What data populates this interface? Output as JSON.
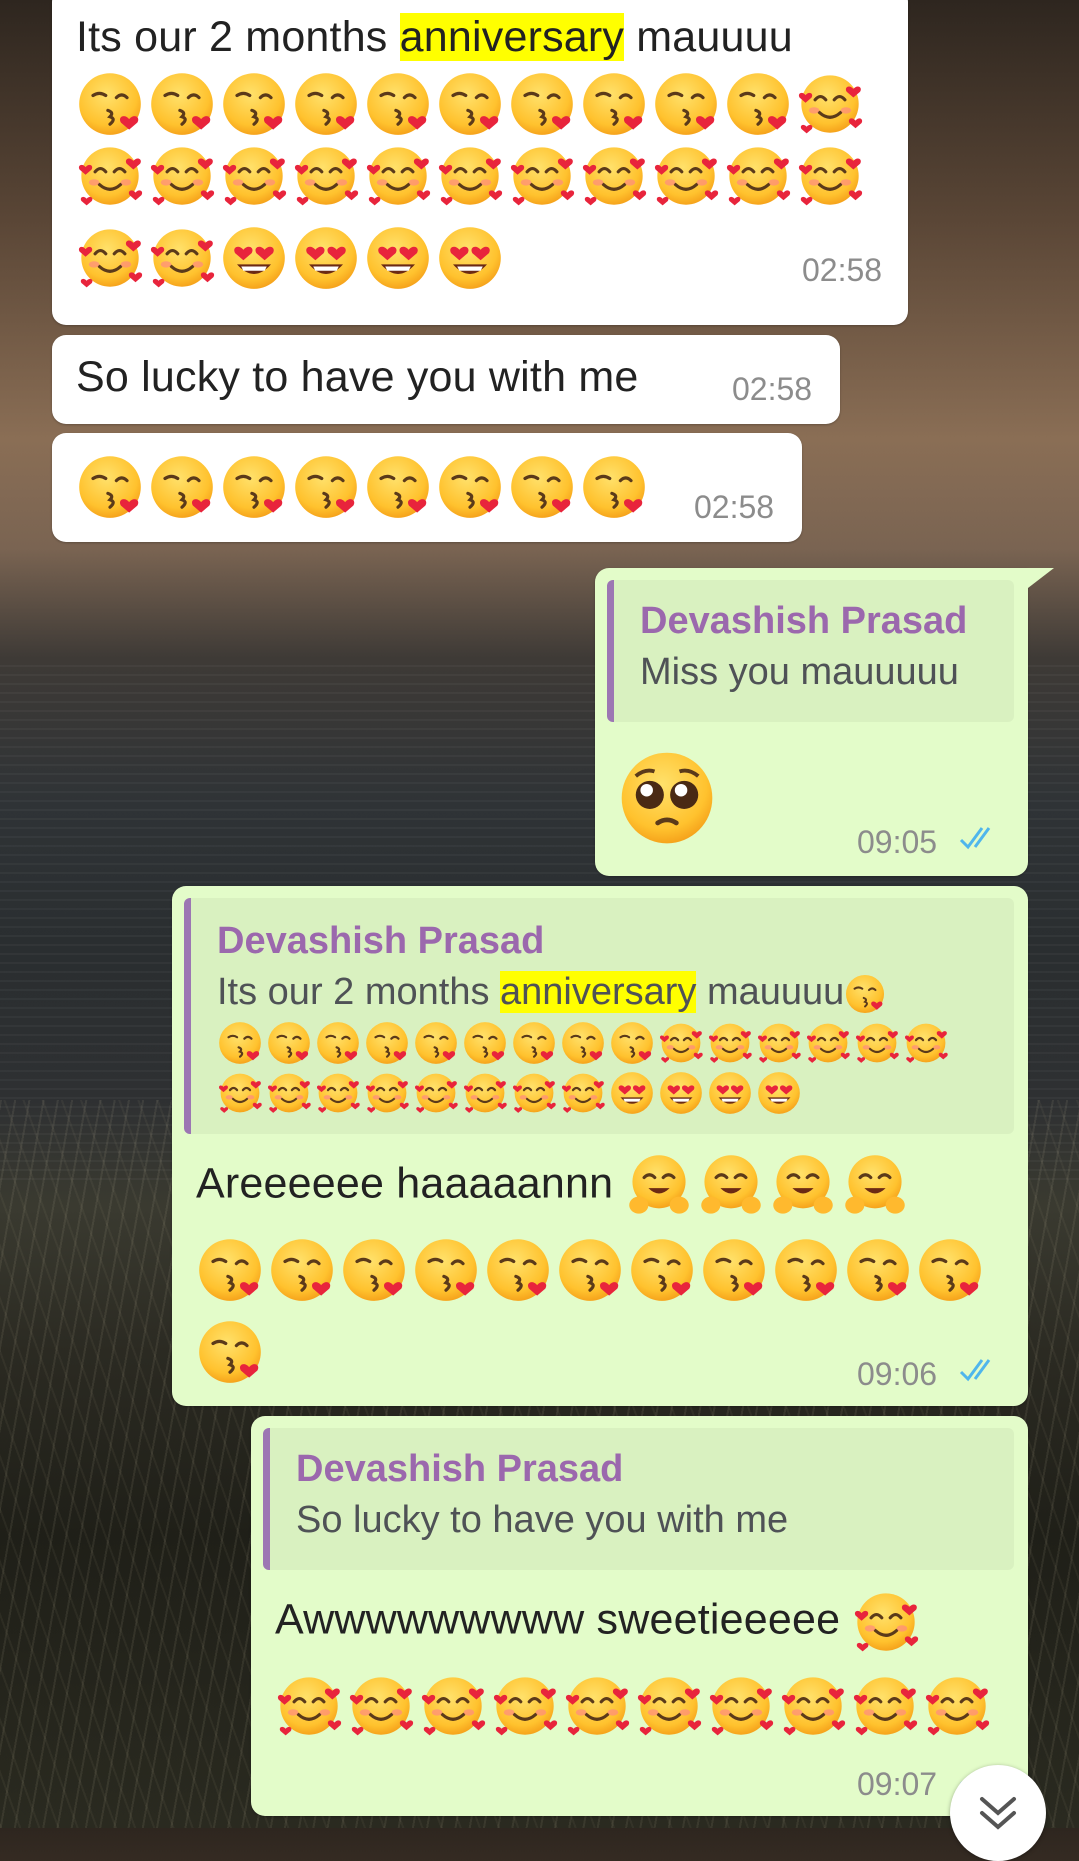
{
  "messages": {
    "m1": {
      "text_before": "Its our 2 months ",
      "highlight": "anniversary",
      "text_after": " mauuuu",
      "time": "02:58"
    },
    "m2": {
      "text": "So lucky to have you with me",
      "time": "02:58"
    },
    "m3": {
      "time": "02:58"
    },
    "m4": {
      "quote_author": "Devashish Prasad",
      "quote_text": "Miss you mauuuuu",
      "time": "09:05"
    },
    "m5": {
      "quote_author": "Devashish Prasad",
      "quote_before": "Its our 2 months ",
      "quote_highlight": "anniversary",
      "quote_after": " mauuuu",
      "text": "Areeeeee haaaaannn",
      "time": "09:06"
    },
    "m6": {
      "quote_author": "Devashish Prasad",
      "quote_text": "So lucky to have you with me",
      "text": "Awwwwwwwww sweetieeeee",
      "time": "09:07"
    }
  },
  "emoji_names": [
    "kissing-heart",
    "smiling-face-with-hearts",
    "heart-eyes",
    "pleading-face",
    "hugging-face"
  ],
  "colors": {
    "incoming": "#ffffff",
    "outgoing": "#e3fcc9",
    "quote_accent": "#9b68ad",
    "read_ticks": "#4fb6ec",
    "highlight": "#ffff00"
  }
}
